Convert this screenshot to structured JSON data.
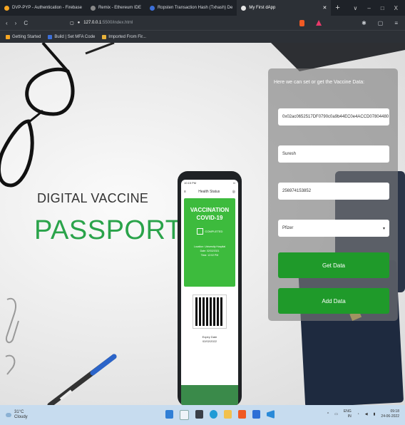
{
  "tabs": [
    {
      "label": "DVP-PYP - Authentication - Firebase",
      "color": "#f6a623"
    },
    {
      "label": "Remix - Ethereum IDE",
      "color": "#888888"
    },
    {
      "label": "Ropsten Transaction Hash (Txhash) De",
      "color": "#3c6fd8"
    },
    {
      "label": "My First dApp",
      "color": "#e6e6e6",
      "active": true
    }
  ],
  "window": {
    "new_tab": "+",
    "minimize": "–",
    "maximize": "□",
    "close": "X",
    "expand": "∨"
  },
  "address": {
    "host": "127.0.0.1",
    "path": ":5500/index.html",
    "back": "‹",
    "forward": "›",
    "reload": "C",
    "bookmark": "▢"
  },
  "bookmarks": [
    {
      "label": "Getting Started",
      "color": "#f6a623"
    },
    {
      "label": "Build | Set MFA Code",
      "color": "#3c6fd8"
    },
    {
      "label": "Imported From Fir...",
      "color": "#e8b23a"
    }
  ],
  "hero": {
    "line1": "DIGITAL VACCINE",
    "line2": "PASSPORT"
  },
  "phone": {
    "time": "10:15 PM",
    "header": "Health Status",
    "card_title1": "VACCINATION",
    "card_title2": "COVID-19",
    "status": "COMPLETED",
    "location": "Location: University Hospital",
    "date": "Date: 02/02/2021",
    "time_line": "Time: 12:02 PM",
    "expiry_label": "Expiry Date",
    "expiry_value": "02/02/2022"
  },
  "form": {
    "title": "Here we can set or get the Vaccine Data:",
    "address_value": "0x02ac0652517DF0790c0a9b44EC0e4ACCD07804480",
    "name_value": "Suresh",
    "id_value": "256974153852",
    "vaccine_value": "Pfizer",
    "get_button": "Get Data",
    "add_button": "Add Data"
  },
  "taskbar": {
    "temp": "31°C",
    "condition": "Cloudy",
    "lang": "ENG",
    "region": "IN",
    "time": "09:18",
    "date": "24-06-2022"
  },
  "colors": {
    "accent": "#1f9a2a",
    "passport_green": "#2aa34a",
    "title_bar": "#1e2228"
  }
}
